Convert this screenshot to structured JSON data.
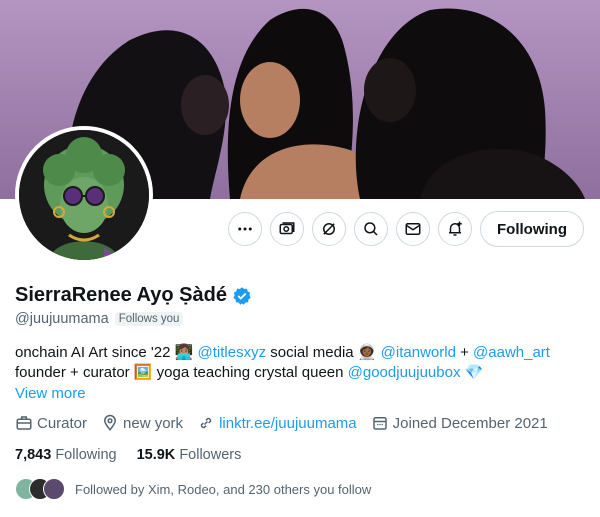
{
  "profile": {
    "name": "SierraRenee Ayọ Ṣàdé",
    "handle": "@juujuumama",
    "follows_you": "Follows you"
  },
  "actions": {
    "following_label": "Following"
  },
  "bio": {
    "line1": [
      {
        "text": "onchain AI Art since '22 ",
        "link": false
      },
      {
        "text": "👩🏽‍💻",
        "link": false
      },
      {
        "text": " ",
        "link": false
      },
      {
        "text": "@titlesxyz",
        "link": true
      },
      {
        "text": " social media ",
        "link": false
      },
      {
        "text": "👩🏾‍🚀",
        "link": false
      },
      {
        "text": " ",
        "link": false
      },
      {
        "text": "@itanworld",
        "link": true
      },
      {
        "text": " + ",
        "link": false
      },
      {
        "text": "@aawh_art",
        "link": true
      }
    ],
    "line2": [
      {
        "text": "founder + curator ",
        "link": false
      },
      {
        "text": "🖼️",
        "link": false
      },
      {
        "text": " yoga teaching crystal queen ",
        "link": false
      },
      {
        "text": "@goodjuujuubox",
        "link": true
      },
      {
        "text": " 💎",
        "link": false
      }
    ],
    "view_more": "View more"
  },
  "meta": {
    "category": "Curator",
    "location": "new york",
    "website": "linktr.ee/juujuumama",
    "joined": "Joined December 2021"
  },
  "stats": {
    "following_count": "7,843",
    "following_label": "Following",
    "followers_count": "15.9K",
    "followers_label": "Followers"
  },
  "followed_by": "Followed by Xim, Rodeo, and 230 others you follow",
  "colors": {
    "accent": "#1d9bf0",
    "banner_bg": "#a98bb5",
    "secondary_text": "#536471"
  }
}
